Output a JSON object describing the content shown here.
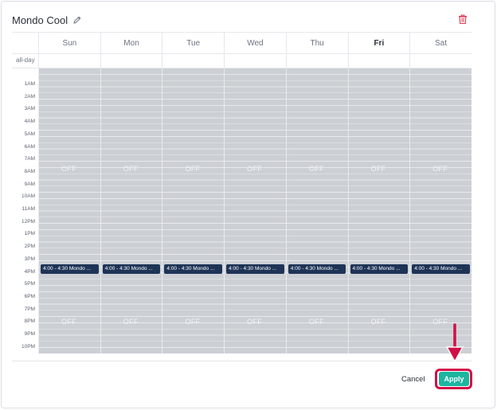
{
  "dialog": {
    "title": "Mondo Cool",
    "edit_icon": "pencil-icon",
    "delete_icon": "trash-icon",
    "delete_color": "#e0334f"
  },
  "calendar": {
    "days": [
      {
        "label": "Sun",
        "bold": false
      },
      {
        "label": "Mon",
        "bold": false
      },
      {
        "label": "Tue",
        "bold": false
      },
      {
        "label": "Wed",
        "bold": false
      },
      {
        "label": "Thu",
        "bold": false
      },
      {
        "label": "Fri",
        "bold": true
      },
      {
        "label": "Sat",
        "bold": false
      }
    ],
    "allday_label": "all-day",
    "hours": [
      "1AM",
      "2AM",
      "3AM",
      "4AM",
      "5AM",
      "6AM",
      "7AM",
      "8AM",
      "9AM",
      "10AM",
      "11AM",
      "12PM",
      "1PM",
      "2PM",
      "3PM",
      "4PM",
      "5PM",
      "6PM",
      "7PM",
      "8PM",
      "9PM",
      "10PM"
    ],
    "off_label": "OFF",
    "event_label": "4:00 - 4:30 Mondo ...",
    "event_color": "#1e3457",
    "off_color": "#ccd0d5"
  },
  "footer": {
    "cancel_label": "Cancel",
    "apply_label": "Apply",
    "apply_color": "#1bb5a0",
    "highlight_color": "#d10f47"
  }
}
